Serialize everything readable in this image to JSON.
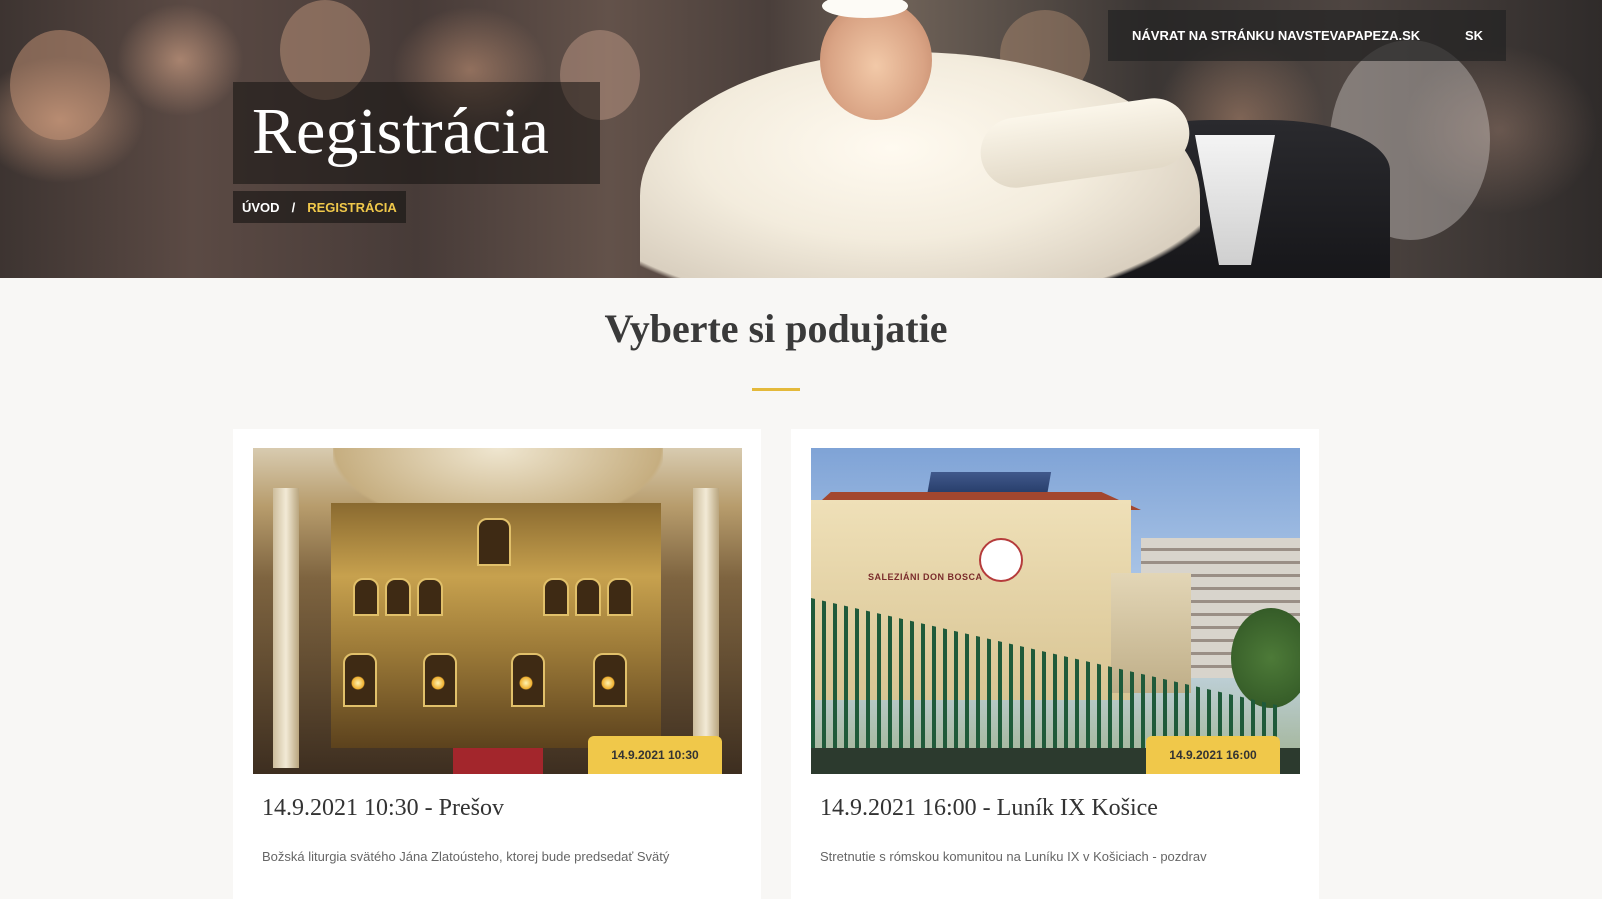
{
  "hero": {
    "title": "Registrácia",
    "breadcrumb": {
      "home": "ÚVOD",
      "separator": "/",
      "current": "REGISTRÁCIA"
    }
  },
  "topbar": {
    "back_link": "NÁVRAT NA STRÁNKU NAVSTEVAPAPEZA.SK",
    "language": "SK"
  },
  "section": {
    "title": "Vyberte si podujatie"
  },
  "events": [
    {
      "badge": "14.9.2021 10:30",
      "title": "14.9.2021 10:30 - Prešov",
      "description": "Božská liturgia svätého Jána Zlatoústeho, ktorej bude predsedať Svätý"
    },
    {
      "badge": "14.9.2021 16:00",
      "title": "14.9.2021 16:00 - Luník IX Košice",
      "description": "Stretnutie s rómskou komunitou na Luníku IX v Košiciach - pozdrav",
      "image_sign": "SALEZIÁNI DON BOSCA"
    }
  ],
  "colors": {
    "accent": "#f0c84a",
    "background": "#f8f7f5",
    "card": "#ffffff"
  }
}
